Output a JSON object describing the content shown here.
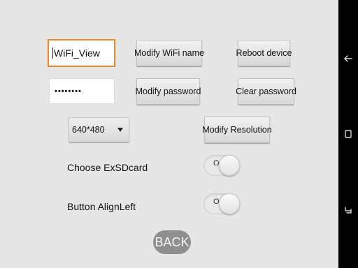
{
  "wifi": {
    "name_value": "WiFi_View",
    "modify_name_label": "Modify WiFi name",
    "password_value": "••••••••",
    "modify_password_label": "Modify password"
  },
  "device": {
    "reboot_label": "Reboot device",
    "clear_password_label": "Clear password"
  },
  "resolution": {
    "selected": "640*480",
    "modify_label": "Modify Resolution"
  },
  "settings": {
    "exsdcard_label": "Choose ExSDcard",
    "exsdcard_toggle_text": "O",
    "align_left_label": "Button AlignLeft",
    "align_left_toggle_text": "O"
  },
  "back_label": "BACK",
  "nav": {
    "icons": [
      "back-arrow-icon",
      "home-square-icon",
      "recent-apps-icon"
    ]
  },
  "colors": {
    "focus_border": "#e98a2a",
    "background": "#e6e6e6",
    "back_button": "#8f8f8f",
    "nav_bar": "#000000"
  }
}
